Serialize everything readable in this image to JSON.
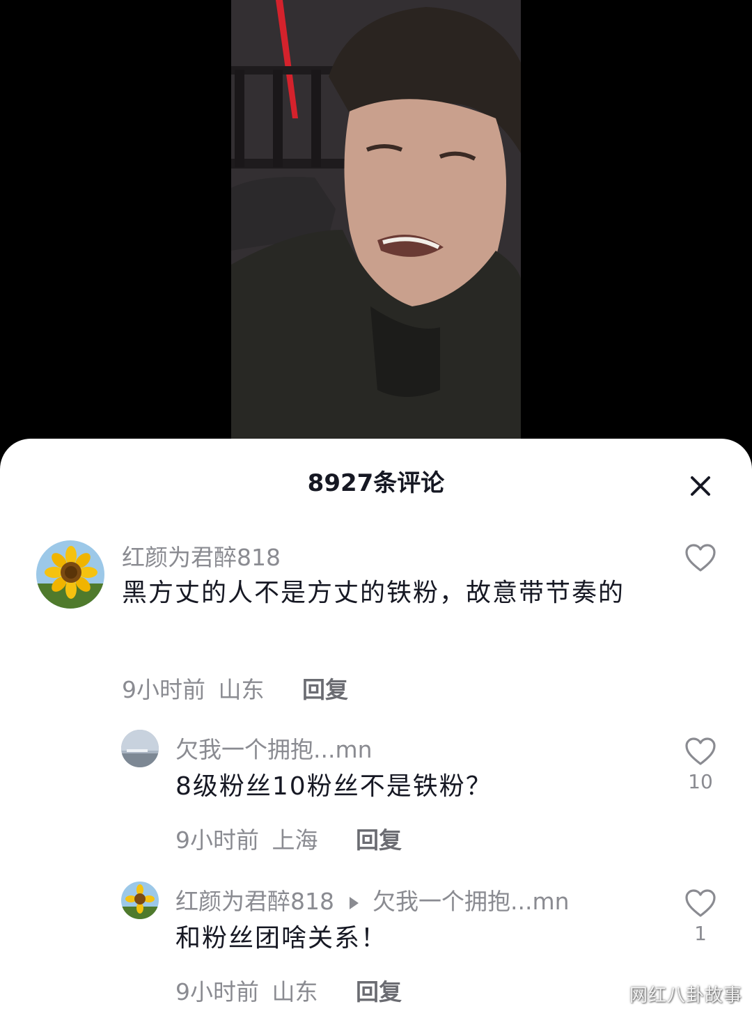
{
  "sheet": {
    "title": "8927条评论"
  },
  "comments": [
    {
      "username": "红颜为君醉818",
      "text": "黑方丈的人不是方丈的铁粉，故意带节奏的",
      "time": "9小时前",
      "location": "山东",
      "reply_label": "回复",
      "likes": ""
    },
    {
      "username": "欠我一个拥抱...mn",
      "text": "8级粉丝10粉丝不是铁粉？",
      "time": "9小时前",
      "location": "上海",
      "reply_label": "回复",
      "likes": "10"
    },
    {
      "username": "红颜为君醉818",
      "reply_to": "欠我一个拥抱...mn",
      "text": "和粉丝团啥关系！",
      "time": "9小时前",
      "location": "山东",
      "reply_label": "回复",
      "likes": "1"
    }
  ],
  "watermark": "网红八卦故事",
  "icons": {
    "close": "close-icon",
    "like": "heart-outline-icon",
    "reply_arrow": "play-triangle-icon"
  }
}
